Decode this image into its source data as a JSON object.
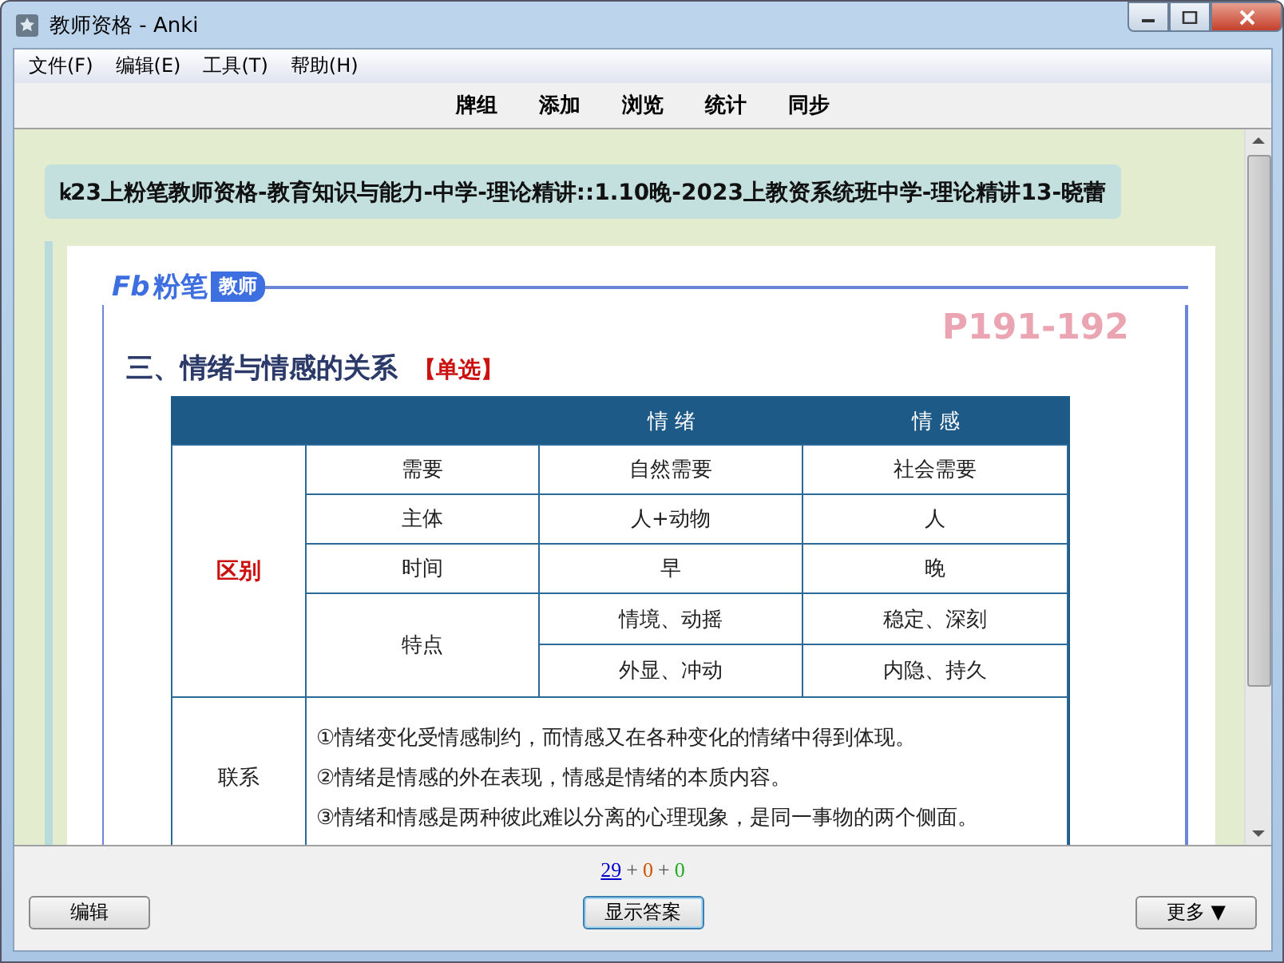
{
  "window": {
    "title": "教师资格 - Anki"
  },
  "menu": [
    "文件(F)",
    "编辑(E)",
    "工具(T)",
    "帮助(H)"
  ],
  "toolbar": [
    "牌组",
    "添加",
    "浏览",
    "统计",
    "同步"
  ],
  "deck_path": "ꝃ23上粉笔教师资格-教育知识与能力-中学-理论精讲::1.10晚-2023上教资系统班中学-理论精讲13-晓蕾",
  "card": {
    "logo": {
      "mark": "Fb",
      "brand": "粉笔",
      "tag": "教师"
    },
    "pages": "P191-192",
    "heading": "三、情绪与情感的关系",
    "tag": "【单选】",
    "table": {
      "columns": [
        "情 绪",
        "情 感"
      ],
      "group_label": "区别",
      "rows": [
        {
          "label": "需要",
          "cells": [
            "自然需要",
            "社会需要"
          ]
        },
        {
          "label": "主体",
          "cells": [
            "人+动物",
            "人"
          ]
        },
        {
          "label": "时间",
          "cells": [
            "早",
            "晚"
          ]
        }
      ],
      "feature": {
        "label": "特点",
        "rows": [
          [
            "情境、动摇",
            "稳定、深刻"
          ],
          [
            "外显、冲动",
            "内隐、持久"
          ]
        ]
      },
      "link": {
        "label": "联系",
        "lines": [
          "①情绪变化受情感制约，而情感又在各种变化的情绪中得到体现。",
          "②情绪是情感的外在表现，情感是情绪的本质内容。",
          "③情绪和情感是两种彼此难以分离的心理现象，是同一事物的两个侧面。"
        ]
      }
    }
  },
  "counts": [
    {
      "value": "29",
      "color": "#0000cc",
      "underlined": true
    },
    {
      "value": "+",
      "color": "#555555",
      "underlined": false
    },
    {
      "value": "0",
      "color": "#cc5500",
      "underlined": false
    },
    {
      "value": "+",
      "color": "#555555",
      "underlined": false
    },
    {
      "value": "0",
      "color": "#22aa22",
      "underlined": false
    }
  ],
  "buttons": [
    {
      "label": "编辑",
      "selected": false
    },
    {
      "label": "显示答案",
      "selected": true
    },
    {
      "label": "更多 ▼",
      "selected": false
    }
  ]
}
